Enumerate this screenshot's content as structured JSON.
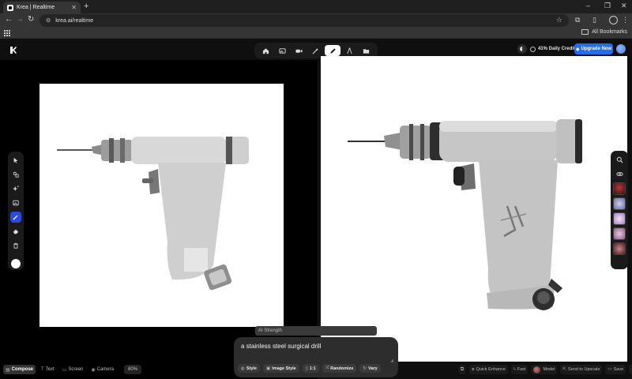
{
  "browser": {
    "tab_title": "Krea | Realtime",
    "new_tab_symbol": "+",
    "url": "krea.ai/realtime",
    "bookmarks_label": "All Bookmarks",
    "window_controls": [
      "–",
      "❐",
      "✕"
    ]
  },
  "header": {
    "credits": "41% Daily Credits",
    "upgrade_label": "Upgrade Now"
  },
  "modes": [
    {
      "name": "home",
      "active": false
    },
    {
      "name": "image",
      "active": false
    },
    {
      "name": "video",
      "active": false
    },
    {
      "name": "enhance",
      "active": false
    },
    {
      "name": "realtime",
      "active": true
    },
    {
      "name": "train",
      "active": false
    },
    {
      "name": "assets",
      "active": false
    }
  ],
  "left_tools": [
    "cursor",
    "shapes",
    "sparkle",
    "image",
    "brush",
    "eraser",
    "trash"
  ],
  "right_rail": {
    "tools": [
      "search",
      "link"
    ],
    "style_thumbs": [
      "#6b1f1f",
      "#8c8cb8",
      "#c9b6d6",
      "#b38fb0",
      "#7a3b3b"
    ]
  },
  "prompt": {
    "ai_strength_label": "AI Strength",
    "text": "a stainless steel surgical drill",
    "chips": [
      {
        "icon": "◍",
        "label": "Style"
      },
      {
        "icon": "▣",
        "label": "Image Style"
      },
      {
        "icon": "▯",
        "label": "1:1"
      },
      {
        "icon": "⤮",
        "label": "Randomize"
      },
      {
        "icon": "↻",
        "label": "Vary"
      }
    ]
  },
  "bottom_left": {
    "tabs": [
      {
        "icon": "▦",
        "label": "Compose",
        "active": true
      },
      {
        "icon": "T",
        "label": "Text",
        "active": false
      },
      {
        "icon": "▭",
        "label": "Screen",
        "active": false
      },
      {
        "icon": "◉",
        "label": "Camera",
        "active": false
      }
    ],
    "zoom": "80%"
  },
  "bottom_right": {
    "quick_enhance": "Quick Enhance",
    "fast": "Fast",
    "model": "Model",
    "send_to_upscale": "Send to Upscale",
    "save": "Save"
  },
  "colors": {
    "accent": "#1d6ef2",
    "active_tool": "#2b48e8",
    "background": "#0f0f0f"
  }
}
